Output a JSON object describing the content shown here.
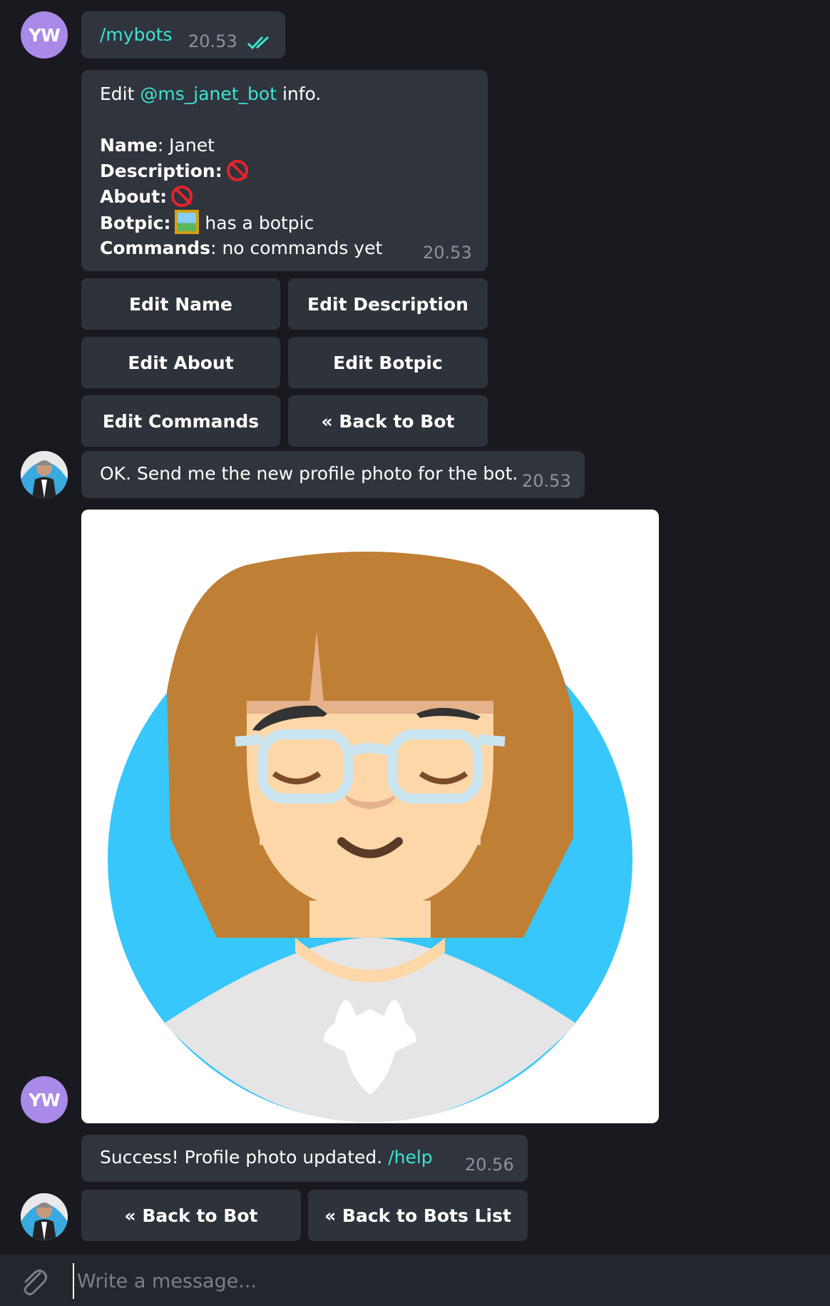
{
  "messages": {
    "cmd": {
      "text": "/mybots",
      "time": "20.53",
      "sender_initials": "YW"
    },
    "info": {
      "intro_prefix": "Edit ",
      "bot_handle": "@ms_janet_bot",
      "intro_suffix": " info.",
      "name_label": "Name",
      "name_value": ": Janet",
      "description_label": "Description:",
      "about_label": "About:",
      "botpic_label": "Botpic:",
      "botpic_value": "has a botpic",
      "commands_label": "Commands",
      "commands_value": ": no commands yet",
      "time": "20.53"
    },
    "prompt": {
      "text": "OK. Send me the new profile photo for the bot.",
      "time": "20.53"
    },
    "photo": {
      "sender_initials": "YW"
    },
    "success": {
      "text": "Success! Profile photo updated. ",
      "link": "/help",
      "time": "20.56"
    }
  },
  "keyboard_edit": [
    "Edit Name",
    "Edit Description",
    "Edit About",
    "Edit Botpic",
    "Edit Commands",
    "« Back to Bot"
  ],
  "keyboard_final": [
    "« Back to Bot",
    "« Back to Bots List"
  ],
  "composer": {
    "placeholder": "Write a message..."
  },
  "colors": {
    "background": "#191a20",
    "bubble": "#2f343d",
    "link": "#3ee3d0",
    "avatar_user": "#a98ae8",
    "photo_circle": "#37c7fa",
    "hair": "#bf7f35"
  }
}
